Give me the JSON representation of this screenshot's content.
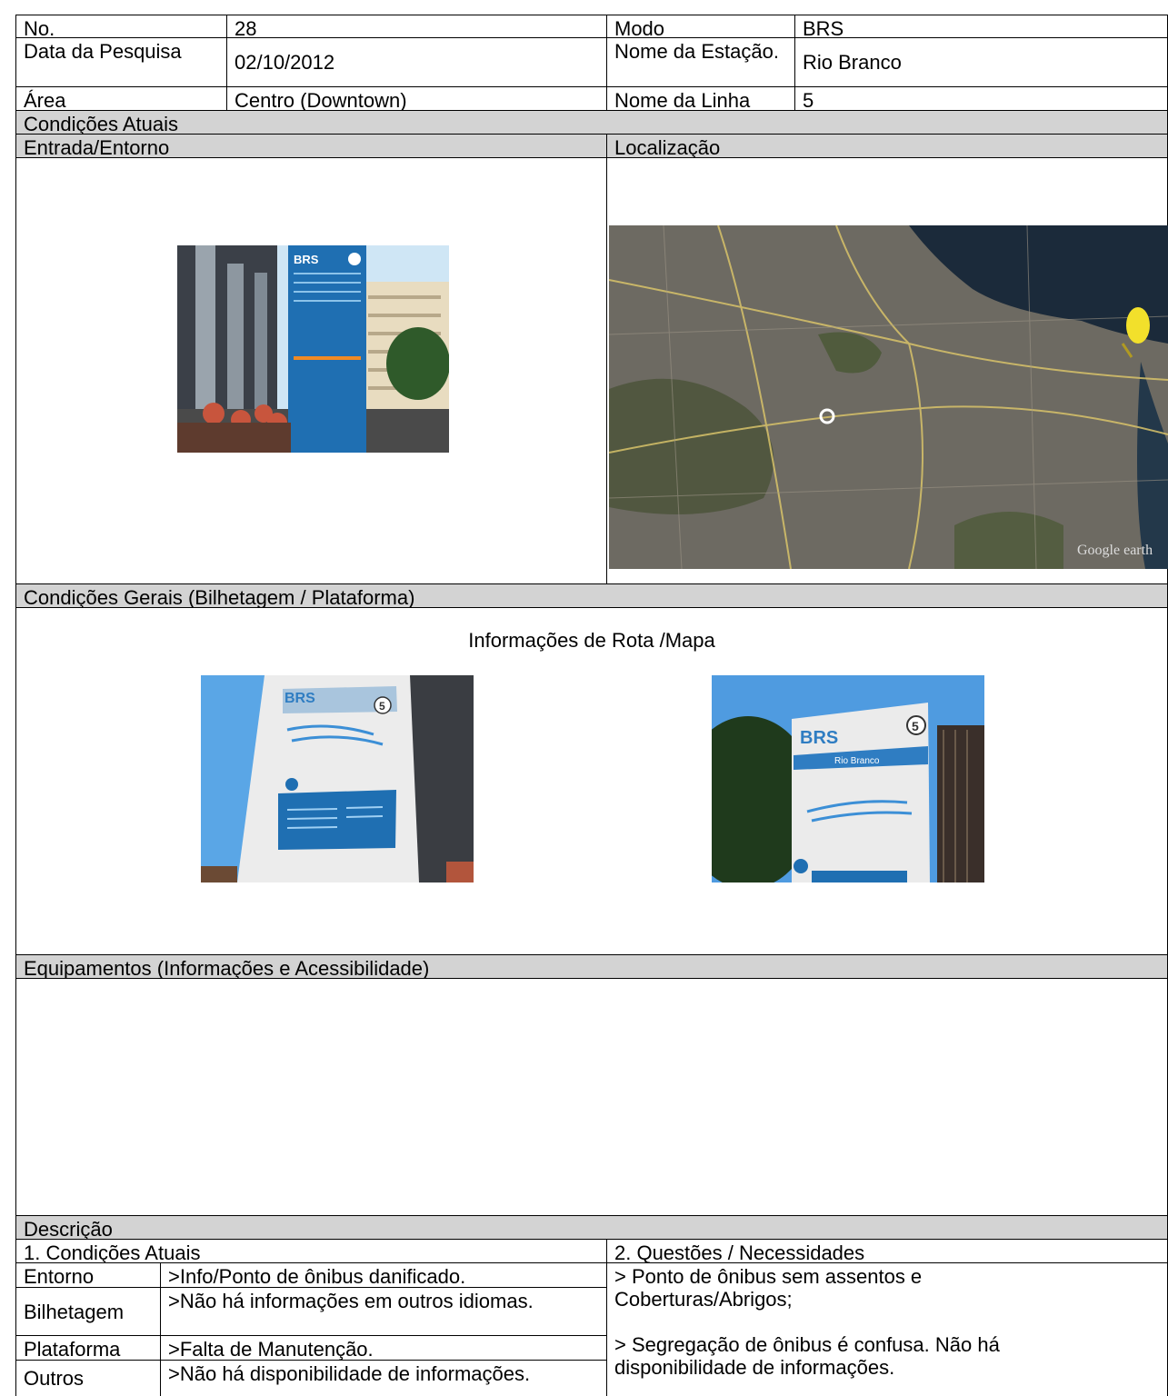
{
  "header": {
    "no_label": "No.",
    "no_value": "28",
    "modo_label": "Modo",
    "modo_value": "BRS",
    "data_label": "Data da Pesquisa",
    "data_value": "02/10/2012",
    "estacao_label": "Nome da Estação.",
    "estacao_value": "Rio Branco",
    "area_label": "Área",
    "area_value": "Centro (Downtown)",
    "linha_label": "Nome da Linha",
    "linha_value": "5"
  },
  "sections": {
    "condicoes_atuais": "Condições Atuais",
    "entrada": "Entrada/Entorno",
    "localizacao": "Localização",
    "condicoes_gerais": "Condições Gerais (Bilhetagem / Plataforma)",
    "info_rota": "Informações de Rota /Mapa",
    "equipamentos": "Equipamentos (Informações e Acessibilidade)",
    "descricao": "Descrição"
  },
  "photos": {
    "sign_brand": "BRS",
    "sign_number": "5",
    "sign_station": "Rio Branco",
    "map_brand": "Google earth"
  },
  "description": {
    "col1_title": "1.   Condições Atuais",
    "col2_title": "2.   Questões / Necessidades",
    "rows": [
      {
        "label": "Entorno",
        "value": ">Info/Ponto de ônibus danificado."
      },
      {
        "label": "Bilhetagem",
        "value": ">Não há informações em outros idiomas."
      },
      {
        "label": "Plataforma",
        "value": ">Falta de Manutenção."
      },
      {
        "label": "Outros",
        "value": ">Não há disponibilidade de informações."
      }
    ],
    "needs": [
      "> Ponto de ônibus sem assentos e Coberturas/Abrigos;",
      "> Segregação de ônibus é confusa. Não há disponibilidade de informações."
    ]
  },
  "colors": {
    "section_gray": "#d3d3d3",
    "brs_blue": "#1f6fb2"
  }
}
